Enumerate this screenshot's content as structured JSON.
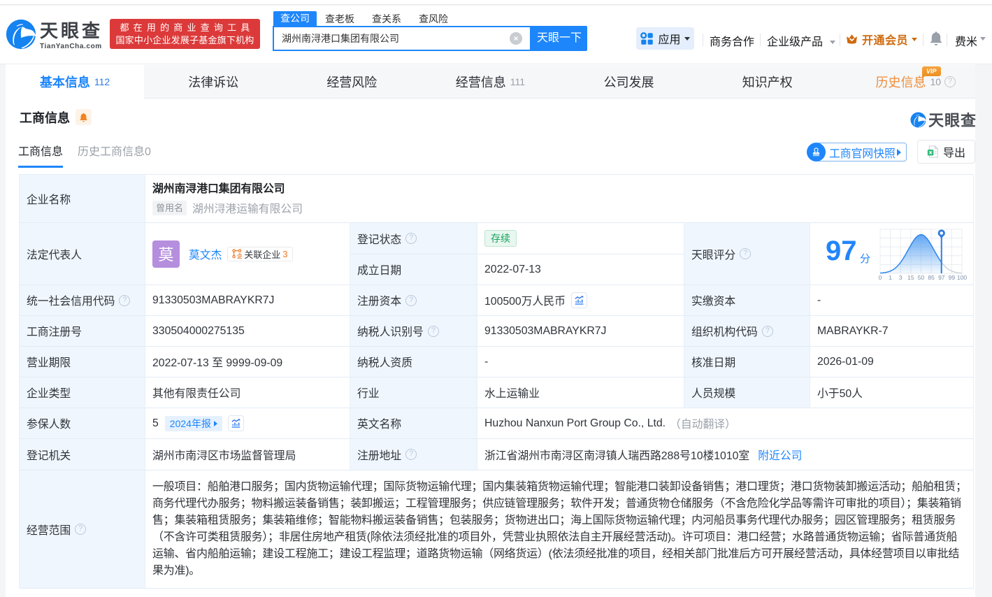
{
  "accent_color": "#1e86fb",
  "icons": {
    "help_glyph": "?",
    "related_enterprise_glyph": "企"
  },
  "header": {
    "logo_title": "天眼查",
    "logo_domain": "TianYanCha.com",
    "slogan_line1": "都在用的商业查询工具",
    "slogan_line2": "国家中小企业发展子基金旗下机构",
    "search": {
      "tabs": [
        {
          "label": "查公司",
          "active": true
        },
        {
          "label": "查老板",
          "active": false
        },
        {
          "label": "查关系",
          "active": false
        },
        {
          "label": "查风险",
          "active": false
        }
      ],
      "value": "湖州南浔港口集团有限公司",
      "button": "天眼一下"
    },
    "menu": {
      "apps": "应用",
      "cooperation": "商务合作",
      "enterprise": "企业级产品",
      "vip": "开通会员",
      "user": "费米"
    }
  },
  "nav": {
    "tabs": [
      {
        "label": "基本信息",
        "count": "112",
        "active": true
      },
      {
        "label": "法律诉讼",
        "count": ""
      },
      {
        "label": "经营风险",
        "count": ""
      },
      {
        "label": "经营信息",
        "count": "111"
      },
      {
        "label": "公司发展",
        "count": ""
      },
      {
        "label": "知识产权",
        "count": ""
      },
      {
        "label": "历史信息",
        "count": "10",
        "vip_badge": "VIP"
      }
    ]
  },
  "section": {
    "title": "工商信息",
    "watermark": "天眼查",
    "tabs": [
      {
        "label": "工商信息",
        "active": true
      },
      {
        "label": "历史工商信息0",
        "active": false
      }
    ],
    "snapshot_button": "工商官网快照",
    "export_button": "导出"
  },
  "table": {
    "company_name_label": "企业名称",
    "company_name": "湖州南浔港口集团有限公司",
    "former_name_tag": "曾用名",
    "former_name": "湖州浔港运输有限公司",
    "legal_rep_label": "法定代表人",
    "legal_rep_avatar": "莫",
    "legal_rep_name": "莫文杰",
    "related_label": "关联企业",
    "related_count": "3",
    "reg_status_label": "登记状态",
    "reg_status": "存续",
    "establish_label": "成立日期",
    "establish_date": "2022-07-13",
    "score_label": "天眼评分",
    "score": "97",
    "score_unit": "分",
    "credit_code_label": "统一社会信用代码",
    "credit_code": "91330503MABRAYKR7J",
    "reg_capital_label": "注册资本",
    "reg_capital": "100500万人民币",
    "paid_capital_label": "实缴资本",
    "paid_capital": "-",
    "reg_number_label": "工商注册号",
    "reg_number": "330504000275135",
    "taxpayer_id_label": "纳税人识别号",
    "taxpayer_id": "91330503MABRAYKR7J",
    "org_code_label": "组织机构代码",
    "org_code": "MABRAYKR-7",
    "business_term_label": "营业期限",
    "business_term": "2022-07-13 至 9999-09-09",
    "taxpayer_quality_label": "纳税人资质",
    "taxpayer_quality": "-",
    "approval_date_label": "核准日期",
    "approval_date": "2026-01-09",
    "company_type_label": "企业类型",
    "company_type": "其他有限责任公司",
    "industry_label": "行业",
    "industry": "水上运输业",
    "staff_size_label": "人员规模",
    "staff_size": "小于50人",
    "insured_label": "参保人数",
    "insured_count": "5",
    "annual_report_tag": "2024年报",
    "english_name_label": "英文名称",
    "english_name": "Huzhou Nanxun Port Group Co., Ltd.",
    "english_name_note": "（自动翻译）",
    "registry_label": "登记机关",
    "registry": "湖州市南浔区市场监督管理局",
    "address_label": "注册地址",
    "address": "浙江省湖州市南浔区南浔镇人瑞西路288号10楼1010室",
    "address_link": "附近公司",
    "scope_label": "经营范围",
    "scope_text": "一般项目：船舶港口服务；国内货物运输代理；国际货物运输代理；国内集装箱货物运输代理；智能港口装卸设备销售；港口理货；港口货物装卸搬运活动；船舶租赁；商务代理代办服务；物料搬运装备销售；装卸搬运；工程管理服务；供应链管理服务；软件开发；普通货物仓储服务（不含危险化学品等需许可审批的项目）；集装箱销售；集装箱租赁服务；集装箱维修；智能物料搬运装备销售；包装服务；货物进出口；海上国际货物运输代理；内河船员事务代理代办服务；园区管理服务；租赁服务（不含许可类租赁服务）；非居住房地产租赁(除依法须经批准的项目外，凭营业执照依法自主开展经营活动)。许可项目：港口经营；水路普通货物运输；省际普通货船运输、省内船舶运输；建设工程施工；建设工程监理；道路货物运输（网络货运）(依法须经批准的项目，经相关部门批准后方可开展经营活动，具体经营项目以审批结果为准)。"
  },
  "chart_data": {
    "type": "area",
    "title": "天眼评分分布曲线",
    "x_ticks": [
      "0",
      "1",
      "3",
      "15",
      "50",
      "85",
      "97",
      "99",
      "100"
    ],
    "marker_value": "97",
    "curve": "normal-distribution peaked at tick 50",
    "ylim": [
      0,
      1
    ]
  }
}
